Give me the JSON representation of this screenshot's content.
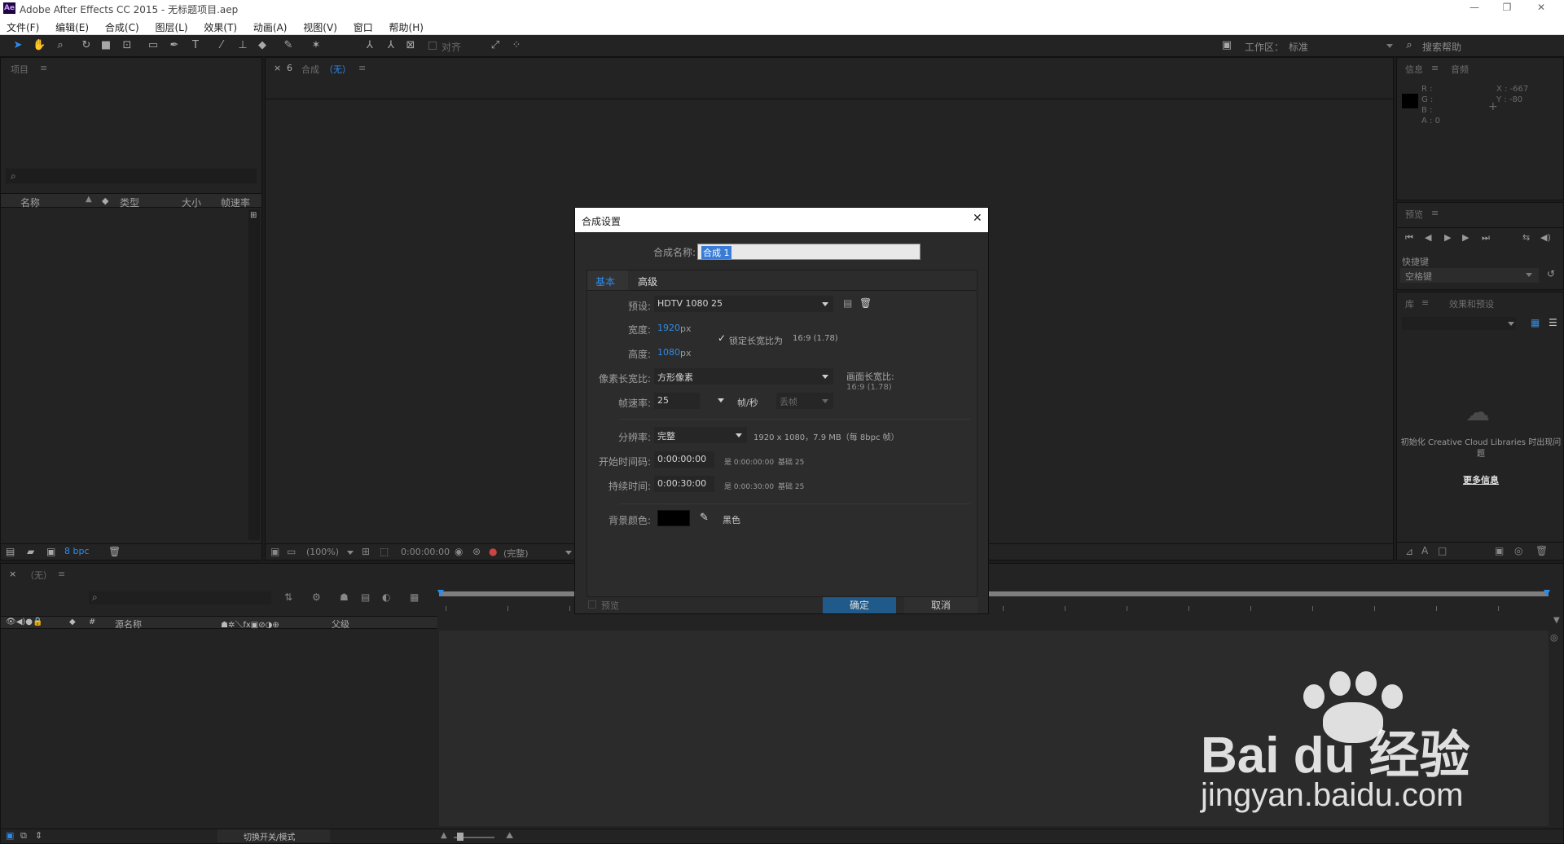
{
  "window": {
    "app_icon": "Ae",
    "title": "Adobe After Effects CC 2015 - 无标题项目.aep",
    "minimize": "—",
    "maximize": "❐",
    "close": "✕"
  },
  "menu": [
    "文件(F)",
    "编辑(E)",
    "合成(C)",
    "图层(L)",
    "效果(T)",
    "动画(A)",
    "视图(V)",
    "窗口",
    "帮助(H)"
  ],
  "toolbar": {
    "snap_label": "对齐",
    "workspace_label": "工作区：",
    "workspace_value": "标准",
    "search_placeholder": "搜索帮助"
  },
  "project_panel": {
    "tab": "项目",
    "search_icon": "⌕",
    "columns": [
      "名称",
      "类型",
      "大小",
      "帧速率"
    ],
    "bpc": "8 bpc"
  },
  "comp_panel": {
    "close": "×",
    "lock": "6",
    "tab": "合成",
    "tab_value": "（无）",
    "zoom": "(100%)",
    "timecode": "0:00:00:00",
    "quality": "(完整)"
  },
  "info_panel": {
    "tabs": [
      "信息",
      "音频"
    ],
    "rgba": [
      "R :",
      "G :",
      "B :",
      "A : 0"
    ],
    "x": "X : -667",
    "y": "Y : -80"
  },
  "preview_panel": {
    "tab": "预览",
    "shortcut_label": "快捷键",
    "shortcut_value": "空格键"
  },
  "library_panel": {
    "tabs": [
      "库",
      "效果和预设"
    ],
    "message": "初始化 Creative Cloud Libraries 时出现问题",
    "more_info": "更多信息"
  },
  "timeline": {
    "close": "×",
    "tab": "（无）",
    "columns": [
      "源名称",
      "父级"
    ],
    "bottom_label": "切换开关/模式"
  },
  "dialog": {
    "title": "合成设置",
    "comp_name_label": "合成名称:",
    "comp_name_value": "合成 1",
    "tabs": [
      "基本",
      "高级"
    ],
    "preset_label": "预设:",
    "preset_value": "HDTV 1080 25",
    "width_label": "宽度:",
    "width_value": "1920",
    "height_label": "高度:",
    "height_value": "1080",
    "px": "px",
    "lock_aspect": "锁定长宽比为",
    "lock_aspect_ratio": "16:9 (1.78)",
    "pixel_aspect_label": "像素长宽比:",
    "pixel_aspect_value": "方形像素",
    "frame_aspect_label": "画面长宽比:",
    "frame_aspect_value": "16:9 (1.78)",
    "fps_label": "帧速率:",
    "fps_value": "25",
    "fps_unit": "帧/秒",
    "drop_frame": "丢帧",
    "resolution_label": "分辨率:",
    "resolution_value": "完整",
    "resolution_info": "1920 x 1080，7.9 MB（每 8bpc 帧）",
    "start_tc_label": "开始时间码:",
    "start_tc_value": "0:00:00:00",
    "start_tc_info": "是 0:00:00:00",
    "start_tc_base": "基础 25",
    "duration_label": "持续时间:",
    "duration_value": "0:00:30:00",
    "duration_info": "是 0:00:30:00",
    "duration_base": "基础 25",
    "bg_color_label": "背景颜色:",
    "bg_color_name": "黑色",
    "preview_label": "预览",
    "ok_label": "确定",
    "cancel_label": "取消"
  },
  "watermark": {
    "brand": "Bai du 经验",
    "url": "jingyan.baidu.com"
  },
  "colors": {
    "accent": "#2d8ceb",
    "bg": "#1c1c1c",
    "panel": "#232323",
    "dialog": "#2a2a2a",
    "ok": "#1f5a8a"
  }
}
